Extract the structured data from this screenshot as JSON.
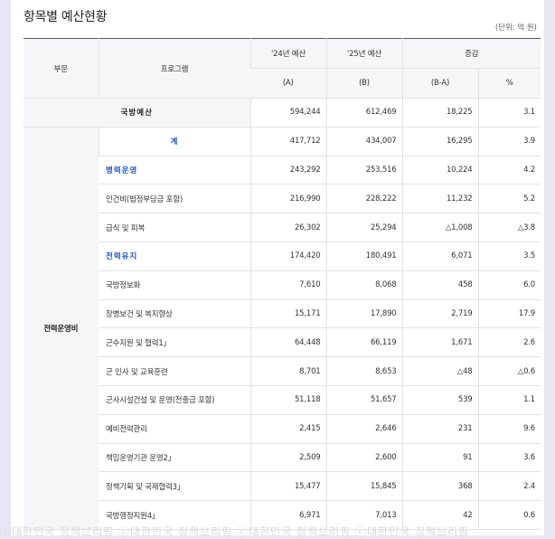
{
  "page": {
    "title": "항목별 예산현황",
    "unit": "(단위: 억 원)"
  },
  "header": {
    "division": "부문",
    "program": "프로그램",
    "budget24": "'24년 예산",
    "budget25": "'25년 예산",
    "change": "증감",
    "col_a": "(A)",
    "col_b": "(B)",
    "col_ba": "(B-A)",
    "col_pct": "%"
  },
  "total_row": {
    "label": "국방예산",
    "a": "594,244",
    "b": "612,469",
    "diff": "18,225",
    "pct": "3.1"
  },
  "sector": {
    "label": "전력운영비"
  },
  "rows": [
    {
      "program": "계",
      "a": "417,712",
      "b": "434,007",
      "diff": "16,295",
      "pct": "3.9"
    },
    {
      "program": "병력운영",
      "a": "243,292",
      "b": "253,516",
      "diff": "10,224",
      "pct": "4.2"
    },
    {
      "program": "인건비(법정부담금 포함)",
      "a": "216,990",
      "b": "228,222",
      "diff": "11,232",
      "pct": "5.2"
    },
    {
      "program": "급식 및 피복",
      "a": "26,302",
      "b": "25,294",
      "diff": "△1,008",
      "pct": "△3.8"
    },
    {
      "program": "전력유지",
      "a": "174,420",
      "b": "180,491",
      "diff": "6,071",
      "pct": "3.5"
    },
    {
      "program": "국방정보화",
      "a": "7,610",
      "b": "8,068",
      "diff": "458",
      "pct": "6.0"
    },
    {
      "program": "장병보건 및 복지향상",
      "a": "15,171",
      "b": "17,890",
      "diff": "2,719",
      "pct": "17.9"
    },
    {
      "program": "군수지원 및 협력1」",
      "a": "64,448",
      "b": "66,119",
      "diff": "1,671",
      "pct": "2.6"
    },
    {
      "program": "군 인사 및 교육훈련",
      "a": "8,701",
      "b": "8,653",
      "diff": "△48",
      "pct": "△0.6"
    },
    {
      "program": "군사시설건설 및 운영(전출금 포함)",
      "a": "51,118",
      "b": "51,657",
      "diff": "539",
      "pct": "1.1"
    },
    {
      "program": "예비전력관리",
      "a": "2,415",
      "b": "2,646",
      "diff": "231",
      "pct": "9.6"
    },
    {
      "program": "책임운영기관 운영2」",
      "a": "2,509",
      "b": "2,600",
      "diff": "91",
      "pct": "3.6"
    },
    {
      "program": "정책기획 및 국제협력3」",
      "a": "15,477",
      "b": "15,845",
      "diff": "368",
      "pct": "2.4"
    },
    {
      "program": "국방행정지원4」",
      "a": "6,971",
      "b": "7,013",
      "diff": "42",
      "pct": "0.6"
    }
  ],
  "watermark": "ⓒ대한민국 정책브리핑 ⓒ대한민국 정책브리핑 ⓒ대한민국 정책브리핑 ⓒ대한민국 정책브리핑"
}
